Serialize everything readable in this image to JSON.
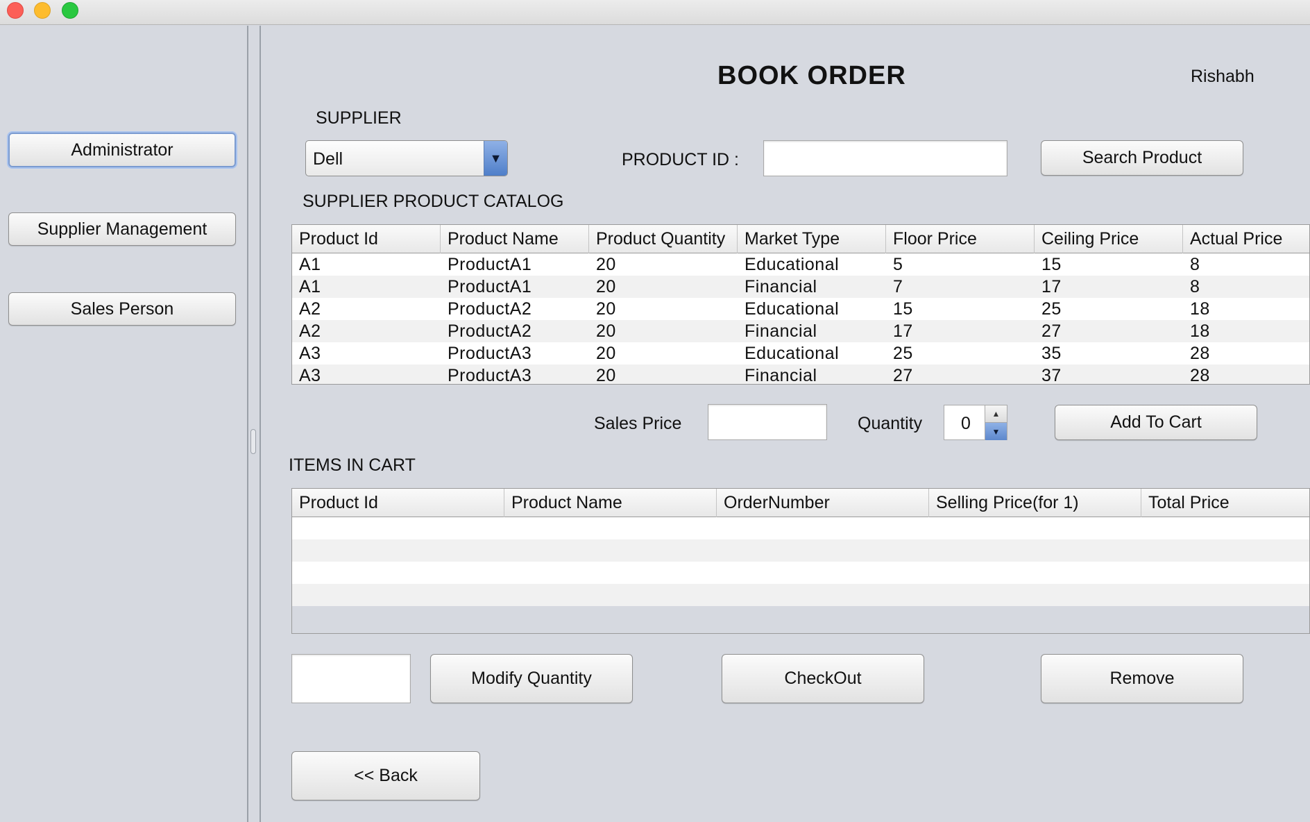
{
  "window": {
    "controls": [
      "close",
      "minimize",
      "zoom"
    ]
  },
  "sidebar": {
    "items": [
      {
        "label": "Administrator"
      },
      {
        "label": "Supplier Management"
      },
      {
        "label": "Sales Person"
      }
    ]
  },
  "header": {
    "title": "BOOK ORDER",
    "user": "Rishabh"
  },
  "supplier": {
    "label": "SUPPLIER",
    "selected": "Dell"
  },
  "product_search": {
    "label": "PRODUCT ID :",
    "value": "",
    "button": "Search Product"
  },
  "catalog": {
    "label": "SUPPLIER PRODUCT CATALOG",
    "columns": [
      "Product Id",
      "Product Name",
      "Product Quantity",
      "Market Type",
      "Floor Price",
      "Ceiling Price",
      "Actual Price"
    ],
    "rows": [
      [
        "A1",
        "ProductA1",
        "20",
        "Educational",
        "5",
        "15",
        "8"
      ],
      [
        "A1",
        "ProductA1",
        "20",
        "Financial",
        "7",
        "17",
        "8"
      ],
      [
        "A2",
        "ProductA2",
        "20",
        "Educational",
        "15",
        "25",
        "18"
      ],
      [
        "A2",
        "ProductA2",
        "20",
        "Financial",
        "17",
        "27",
        "18"
      ],
      [
        "A3",
        "ProductA3",
        "20",
        "Educational",
        "25",
        "35",
        "28"
      ],
      [
        "A3",
        "ProductA3",
        "20",
        "Financial",
        "27",
        "37",
        "28"
      ]
    ]
  },
  "add_to_cart": {
    "sales_price_label": "Sales Price",
    "sales_price_value": "",
    "quantity_label": "Quantity",
    "quantity_value": "0",
    "button": "Add To Cart"
  },
  "cart": {
    "label": "ITEMS IN CART",
    "columns": [
      "Product Id",
      "Product Name",
      "OrderNumber",
      "Selling Price(for 1)",
      "Total Price"
    ],
    "rows": []
  },
  "actions": {
    "modify_value": "",
    "modify_button": "Modify Quantity",
    "checkout_button": "CheckOut",
    "remove_button": "Remove",
    "back_button": "<< Back"
  }
}
